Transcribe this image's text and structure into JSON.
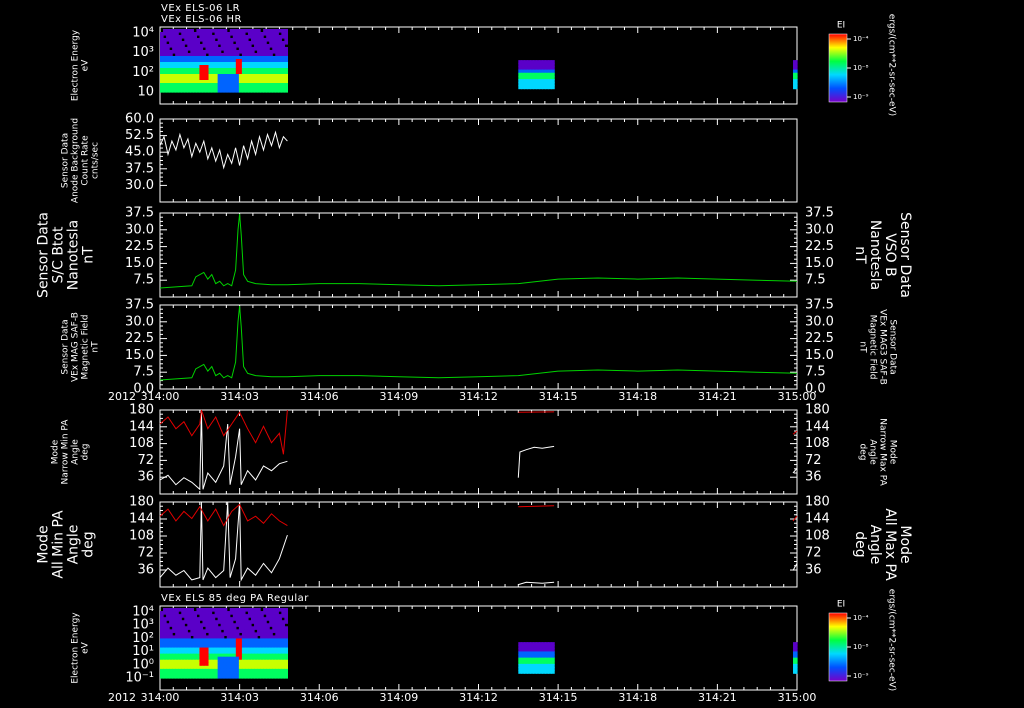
{
  "titles": {
    "top_line1": "VEx ELS-06 LR",
    "top_line2": "VEx ELS-06 HR",
    "bottom": "VEx ELS 85 deg PA Regular"
  },
  "colorbars": [
    {
      "label": "EI",
      "ticks": [
        "10⁻⁴",
        "10⁻⁸",
        "10⁻⁹"
      ],
      "unit": "ergs/(cm**2-sr-sec-eV)"
    },
    {
      "label": "EI",
      "ticks": [
        "10⁻⁴",
        "10⁻⁸",
        "10⁻⁹"
      ],
      "unit": "ergs/(cm**2-sr-sec-eV)"
    }
  ],
  "x_axis": {
    "year": "2012",
    "ticks": [
      "314:00",
      "314:03",
      "314:06",
      "314:09",
      "314:12",
      "314:15",
      "314:18",
      "314:21",
      "315:00"
    ]
  },
  "chart_data": [
    {
      "type": "heatmap",
      "ylabel": [
        "Electron Energy",
        "eV"
      ],
      "yticks": [
        "10⁴",
        "10³",
        "10²",
        "10"
      ],
      "yscale": "log",
      "data_blocks_x": [
        [
          0,
          1.6
        ],
        [
          4.5,
          4.95
        ],
        [
          7.95,
          8
        ]
      ],
      "colors": [
        "#5a00c8",
        "#0064ff",
        "#00d8ff",
        "#00ff60",
        "#c8ff00",
        "#ff0000"
      ]
    },
    {
      "type": "line",
      "ylabel": [
        "Sensor Data",
        "Anode Background",
        "Count Rate",
        "cnts/sec"
      ],
      "yticks": [
        "60.0",
        "52.5",
        "45.0",
        "37.5",
        "30.0"
      ],
      "ylim": [
        22.5,
        60
      ],
      "series": [
        {
          "color": "#ffffff",
          "points": [
            [
              0,
              48
            ],
            [
              0.05,
              52
            ],
            [
              0.1,
              44
            ],
            [
              0.15,
              50
            ],
            [
              0.2,
              46
            ],
            [
              0.25,
              53
            ],
            [
              0.3,
              47
            ],
            [
              0.35,
              51
            ],
            [
              0.4,
              43
            ],
            [
              0.45,
              49
            ],
            [
              0.5,
              45
            ],
            [
              0.55,
              50
            ],
            [
              0.6,
              42
            ],
            [
              0.65,
              47
            ],
            [
              0.7,
              41
            ],
            [
              0.75,
              46
            ],
            [
              0.8,
              38
            ],
            [
              0.85,
              44
            ],
            [
              0.9,
              40
            ],
            [
              0.95,
              47
            ],
            [
              1.0,
              39
            ],
            [
              1.05,
              48
            ],
            [
              1.1,
              42
            ],
            [
              1.15,
              50
            ],
            [
              1.2,
              44
            ],
            [
              1.25,
              52
            ],
            [
              1.3,
              46
            ],
            [
              1.35,
              53
            ],
            [
              1.4,
              48
            ],
            [
              1.45,
              54
            ],
            [
              1.5,
              47
            ],
            [
              1.55,
              52
            ],
            [
              1.6,
              50
            ]
          ]
        }
      ]
    },
    {
      "type": "line",
      "ylabel": [
        "Sensor Data",
        "S/C Btot",
        "Nanotesla",
        "nT"
      ],
      "right_label": [
        "Sensor Data",
        "VSO B",
        "Nanotesla",
        "nT"
      ],
      "yticks": [
        "37.5",
        "30.0",
        "22.5",
        "15.0",
        "7.5"
      ],
      "ylim": [
        0,
        37.5
      ],
      "series": [
        {
          "color": "#00d200",
          "points": [
            [
              0,
              4
            ],
            [
              0.2,
              4.5
            ],
            [
              0.4,
              5
            ],
            [
              0.45,
              9
            ],
            [
              0.55,
              11
            ],
            [
              0.6,
              8
            ],
            [
              0.65,
              10
            ],
            [
              0.7,
              6
            ],
            [
              0.75,
              7
            ],
            [
              0.8,
              5
            ],
            [
              0.85,
              6
            ],
            [
              0.9,
              5
            ],
            [
              0.95,
              12
            ],
            [
              0.98,
              30
            ],
            [
              1.0,
              37
            ],
            [
              1.02,
              28
            ],
            [
              1.05,
              10
            ],
            [
              1.1,
              7
            ],
            [
              1.2,
              6
            ],
            [
              1.4,
              5.5
            ],
            [
              1.6,
              5.5
            ],
            [
              2,
              6
            ],
            [
              2.5,
              6
            ],
            [
              3,
              5.5
            ],
            [
              3.5,
              5
            ],
            [
              4,
              5.5
            ],
            [
              4.5,
              6
            ],
            [
              5,
              8
            ],
            [
              5.5,
              8.5
            ],
            [
              6,
              8
            ],
            [
              6.5,
              8.5
            ],
            [
              7,
              8
            ],
            [
              7.5,
              7.5
            ],
            [
              8,
              7
            ]
          ]
        }
      ]
    },
    {
      "type": "line",
      "ylabel": [
        "Sensor Data",
        "VEx MAG SAF-B",
        "Magnetic Field",
        "nT"
      ],
      "right_label": [
        "Sensor Data",
        "VEx MAG3 SAF-B",
        "Magnetic Field",
        "nT"
      ],
      "yticks": [
        "37.5",
        "30.0",
        "22.5",
        "15.0",
        "7.5",
        "0.0"
      ],
      "ylim": [
        0,
        37.5
      ],
      "series": [
        {
          "color": "#00d200",
          "points": [
            [
              0,
              4
            ],
            [
              0.2,
              4.5
            ],
            [
              0.4,
              5
            ],
            [
              0.45,
              9
            ],
            [
              0.55,
              11
            ],
            [
              0.6,
              8
            ],
            [
              0.65,
              10
            ],
            [
              0.7,
              6
            ],
            [
              0.75,
              7
            ],
            [
              0.8,
              5
            ],
            [
              0.85,
              6
            ],
            [
              0.9,
              5
            ],
            [
              0.95,
              12
            ],
            [
              0.98,
              30
            ],
            [
              1.0,
              37
            ],
            [
              1.02,
              28
            ],
            [
              1.05,
              10
            ],
            [
              1.1,
              7
            ],
            [
              1.2,
              6
            ],
            [
              1.4,
              5.5
            ],
            [
              1.6,
              5.5
            ],
            [
              2,
              6
            ],
            [
              2.5,
              6
            ],
            [
              3,
              5.5
            ],
            [
              3.5,
              5
            ],
            [
              4,
              5.5
            ],
            [
              4.5,
              6
            ],
            [
              5,
              8
            ],
            [
              5.5,
              8.5
            ],
            [
              6,
              8
            ],
            [
              6.5,
              8.5
            ],
            [
              7,
              8
            ],
            [
              7.5,
              7.5
            ],
            [
              8,
              7
            ]
          ]
        }
      ]
    },
    {
      "type": "line",
      "ylabel": [
        "Mode",
        "Narrow Min PA",
        "Angle",
        "deg"
      ],
      "right_label": [
        "Mode",
        "Narrow Max PA",
        "Angle",
        "deg"
      ],
      "yticks": [
        "180",
        "144",
        "108",
        "72",
        "36"
      ],
      "ylim": [
        0,
        180
      ],
      "series": [
        {
          "color": "#ffffff",
          "points": [
            [
              0,
              30
            ],
            [
              0.1,
              40
            ],
            [
              0.2,
              20
            ],
            [
              0.3,
              35
            ],
            [
              0.4,
              25
            ],
            [
              0.5,
              10
            ],
            [
              0.52,
              180
            ],
            [
              0.54,
              10
            ],
            [
              0.6,
              45
            ],
            [
              0.7,
              25
            ],
            [
              0.8,
              60
            ],
            [
              0.85,
              150
            ],
            [
              0.88,
              20
            ],
            [
              0.95,
              80
            ],
            [
              1.0,
              140
            ],
            [
              1.02,
              20
            ],
            [
              1.1,
              50
            ],
            [
              1.2,
              30
            ],
            [
              1.3,
              60
            ],
            [
              1.4,
              50
            ],
            [
              1.5,
              65
            ],
            [
              1.6,
              70
            ]
          ]
        },
        {
          "color": "#ffffff",
          "points": [
            [
              4.5,
              35
            ],
            [
              4.52,
              90
            ],
            [
              4.6,
              95
            ],
            [
              4.7,
              100
            ],
            [
              4.8,
              98
            ],
            [
              4.95,
              102
            ]
          ]
        },
        {
          "color": "#ffffff",
          "points": [
            [
              7.95,
              45
            ],
            [
              8,
              55
            ]
          ]
        },
        {
          "color": "#e10000",
          "points": [
            [
              0,
              150
            ],
            [
              0.1,
              165
            ],
            [
              0.2,
              140
            ],
            [
              0.3,
              155
            ],
            [
              0.4,
              125
            ],
            [
              0.5,
              150
            ],
            [
              0.52,
              180
            ],
            [
              0.6,
              140
            ],
            [
              0.7,
              165
            ],
            [
              0.8,
              125
            ],
            [
              0.9,
              150
            ],
            [
              1.0,
              175
            ],
            [
              1.1,
              140
            ],
            [
              1.2,
              110
            ],
            [
              1.3,
              145
            ],
            [
              1.4,
              110
            ],
            [
              1.5,
              130
            ],
            [
              1.55,
              85
            ],
            [
              1.6,
              180
            ]
          ]
        },
        {
          "color": "#e10000",
          "points": [
            [
              4.5,
              175
            ],
            [
              4.95,
              176
            ]
          ]
        },
        {
          "color": "#e10000",
          "points": [
            [
              7.95,
              128
            ],
            [
              8,
              135
            ]
          ]
        }
      ]
    },
    {
      "type": "line",
      "ylabel": [
        "Mode",
        "All Min PA",
        "Angle",
        "deg"
      ],
      "right_label": [
        "Mode",
        "All Max PA",
        "Angle",
        "deg"
      ],
      "yticks": [
        "180",
        "144",
        "108",
        "72",
        "36"
      ],
      "ylim": [
        0,
        180
      ],
      "series": [
        {
          "color": "#ffffff",
          "points": [
            [
              0,
              20
            ],
            [
              0.1,
              40
            ],
            [
              0.2,
              25
            ],
            [
              0.3,
              35
            ],
            [
              0.4,
              15
            ],
            [
              0.5,
              20
            ],
            [
              0.52,
              180
            ],
            [
              0.54,
              15
            ],
            [
              0.6,
              40
            ],
            [
              0.7,
              20
            ],
            [
              0.8,
              35
            ],
            [
              0.85,
              180
            ],
            [
              0.88,
              20
            ],
            [
              0.95,
              60
            ],
            [
              1.0,
              180
            ],
            [
              1.02,
              15
            ],
            [
              1.1,
              40
            ],
            [
              1.2,
              25
            ],
            [
              1.3,
              50
            ],
            [
              1.4,
              30
            ],
            [
              1.5,
              60
            ],
            [
              1.6,
              110
            ]
          ]
        },
        {
          "color": "#ffffff",
          "points": [
            [
              4.5,
              5
            ],
            [
              4.6,
              10
            ],
            [
              4.8,
              8
            ],
            [
              4.95,
              10
            ]
          ]
        },
        {
          "color": "#ffffff",
          "points": [
            [
              7.95,
              35
            ],
            [
              8,
              50
            ]
          ]
        },
        {
          "color": "#e10000",
          "points": [
            [
              0,
              150
            ],
            [
              0.1,
              165
            ],
            [
              0.2,
              140
            ],
            [
              0.3,
              160
            ],
            [
              0.4,
              145
            ],
            [
              0.5,
              170
            ],
            [
              0.6,
              140
            ],
            [
              0.7,
              165
            ],
            [
              0.8,
              130
            ],
            [
              0.9,
              160
            ],
            [
              1.0,
              175
            ],
            [
              1.1,
              140
            ],
            [
              1.2,
              150
            ],
            [
              1.3,
              135
            ],
            [
              1.4,
              155
            ],
            [
              1.5,
              140
            ],
            [
              1.6,
              130
            ]
          ]
        },
        {
          "color": "#e10000",
          "points": [
            [
              4.5,
              170
            ],
            [
              4.95,
              172
            ]
          ]
        },
        {
          "color": "#e10000",
          "points": [
            [
              7.95,
              140
            ],
            [
              8,
              150
            ]
          ]
        }
      ]
    },
    {
      "type": "heatmap",
      "ylabel": [
        "Electron Energy",
        "eV"
      ],
      "yticks": [
        "10⁴",
        "10³",
        "10²",
        "10¹",
        "10⁰",
        "10⁻¹"
      ],
      "yscale": "log",
      "data_blocks_x": [
        [
          0,
          1.6
        ],
        [
          4.5,
          4.95
        ],
        [
          7.95,
          8
        ]
      ],
      "colors": [
        "#5a00c8",
        "#0064ff",
        "#00d8ff",
        "#00ff60",
        "#c8ff00",
        "#ff0000"
      ]
    }
  ]
}
